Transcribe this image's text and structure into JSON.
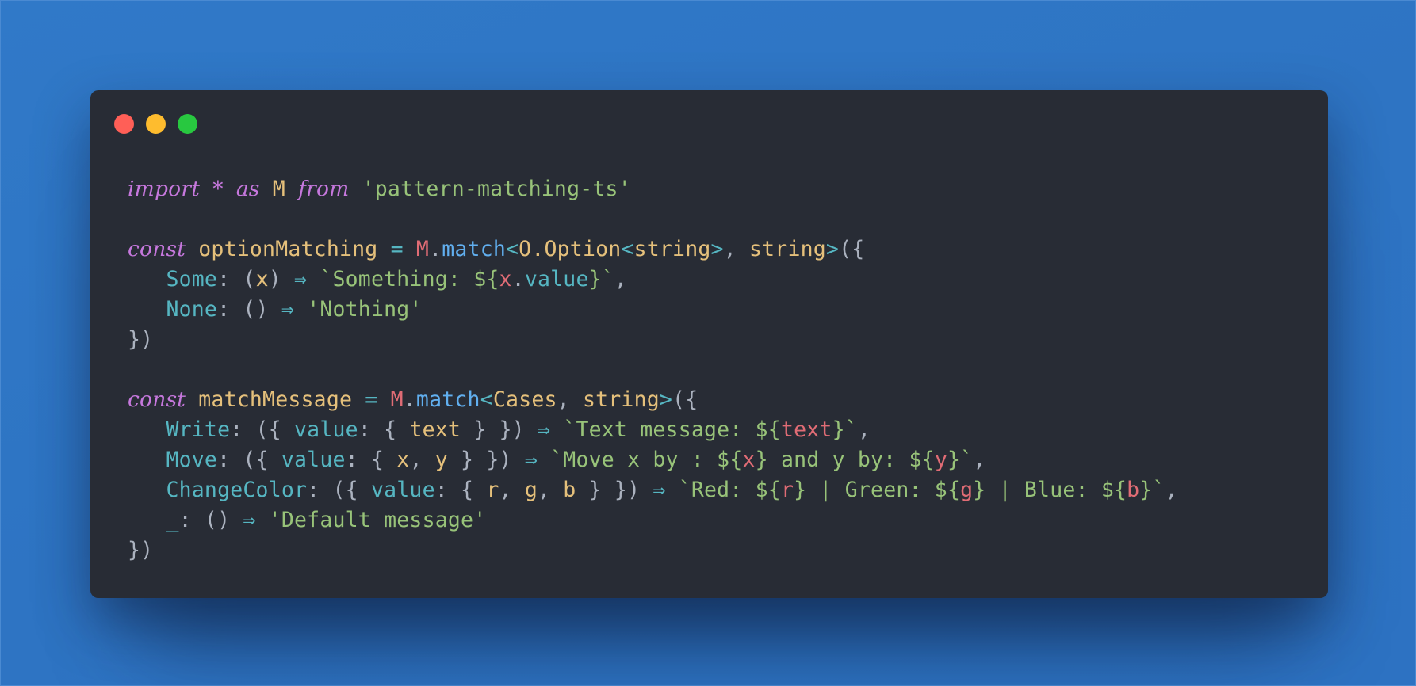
{
  "colors": {
    "background": "#2e75c4",
    "window": "#282c35",
    "dot_close": "#ff5f57",
    "dot_minimize": "#febc2e",
    "dot_maximize": "#28c840",
    "keyword": "#c678dd",
    "identifier": "#e5c07b",
    "string": "#98c379",
    "variable": "#e06c75",
    "function": "#61afef",
    "property": "#56b6c2",
    "punctuation": "#abb2bf"
  },
  "window_controls": [
    "close",
    "minimize",
    "maximize"
  ],
  "code": {
    "language": "typescript",
    "lines": [
      [
        [
          "kw",
          "import"
        ],
        [
          "punct",
          " "
        ],
        [
          "kw",
          "*"
        ],
        [
          "punct",
          " "
        ],
        [
          "kw",
          "as"
        ],
        [
          "punct",
          " "
        ],
        [
          "id",
          "M"
        ],
        [
          "punct",
          " "
        ],
        [
          "kw",
          "from"
        ],
        [
          "punct",
          " "
        ],
        [
          "str",
          "'pattern-matching-ts'"
        ]
      ],
      [],
      [
        [
          "kw",
          "const"
        ],
        [
          "punct",
          " "
        ],
        [
          "id",
          "optionMatching"
        ],
        [
          "punct",
          " "
        ],
        [
          "op",
          "="
        ],
        [
          "punct",
          " "
        ],
        [
          "red",
          "M"
        ],
        [
          "punct",
          "."
        ],
        [
          "fn",
          "match"
        ],
        [
          "op",
          "<"
        ],
        [
          "id",
          "O.Option"
        ],
        [
          "op",
          "<"
        ],
        [
          "id",
          "string"
        ],
        [
          "op",
          ">"
        ],
        [
          "punct",
          ", "
        ],
        [
          "id",
          "string"
        ],
        [
          "op",
          ">"
        ],
        [
          "punct",
          "({"
        ]
      ],
      [
        [
          "punct",
          "   "
        ],
        [
          "prop",
          "Some"
        ],
        [
          "punct",
          ": ("
        ],
        [
          "id",
          "x"
        ],
        [
          "punct",
          ") "
        ],
        [
          "arrow",
          "⇒"
        ],
        [
          "punct",
          " "
        ],
        [
          "str",
          "`Something: ${"
        ],
        [
          "red",
          "x"
        ],
        [
          "punct",
          "."
        ],
        [
          "prop",
          "value"
        ],
        [
          "str",
          "}`"
        ],
        [
          "punct",
          ","
        ]
      ],
      [
        [
          "punct",
          "   "
        ],
        [
          "prop",
          "None"
        ],
        [
          "punct",
          ": () "
        ],
        [
          "arrow",
          "⇒"
        ],
        [
          "punct",
          " "
        ],
        [
          "str",
          "'Nothing'"
        ]
      ],
      [
        [
          "punct",
          "})"
        ]
      ],
      [],
      [
        [
          "kw",
          "const"
        ],
        [
          "punct",
          " "
        ],
        [
          "id",
          "matchMessage"
        ],
        [
          "punct",
          " "
        ],
        [
          "op",
          "="
        ],
        [
          "punct",
          " "
        ],
        [
          "red",
          "M"
        ],
        [
          "punct",
          "."
        ],
        [
          "fn",
          "match"
        ],
        [
          "op",
          "<"
        ],
        [
          "id",
          "Cases"
        ],
        [
          "punct",
          ", "
        ],
        [
          "id",
          "string"
        ],
        [
          "op",
          ">"
        ],
        [
          "punct",
          "({"
        ]
      ],
      [
        [
          "punct",
          "   "
        ],
        [
          "prop",
          "Write"
        ],
        [
          "punct",
          ": ({ "
        ],
        [
          "prop",
          "value"
        ],
        [
          "punct",
          ": { "
        ],
        [
          "id",
          "text"
        ],
        [
          "punct",
          " } }) "
        ],
        [
          "arrow",
          "⇒"
        ],
        [
          "punct",
          " "
        ],
        [
          "str",
          "`Text message: ${"
        ],
        [
          "red",
          "text"
        ],
        [
          "str",
          "}`"
        ],
        [
          "punct",
          ","
        ]
      ],
      [
        [
          "punct",
          "   "
        ],
        [
          "prop",
          "Move"
        ],
        [
          "punct",
          ": ({ "
        ],
        [
          "prop",
          "value"
        ],
        [
          "punct",
          ": { "
        ],
        [
          "id",
          "x"
        ],
        [
          "punct",
          ", "
        ],
        [
          "id",
          "y"
        ],
        [
          "punct",
          " } }) "
        ],
        [
          "arrow",
          "⇒"
        ],
        [
          "punct",
          " "
        ],
        [
          "str",
          "`Move x by : ${"
        ],
        [
          "red",
          "x"
        ],
        [
          "str",
          "} and y by: ${"
        ],
        [
          "red",
          "y"
        ],
        [
          "str",
          "}`"
        ],
        [
          "punct",
          ","
        ]
      ],
      [
        [
          "punct",
          "   "
        ],
        [
          "prop",
          "ChangeColor"
        ],
        [
          "punct",
          ": ({ "
        ],
        [
          "prop",
          "value"
        ],
        [
          "punct",
          ": { "
        ],
        [
          "id",
          "r"
        ],
        [
          "punct",
          ", "
        ],
        [
          "id",
          "g"
        ],
        [
          "punct",
          ", "
        ],
        [
          "id",
          "b"
        ],
        [
          "punct",
          " } }) "
        ],
        [
          "arrow",
          "⇒"
        ],
        [
          "punct",
          " "
        ],
        [
          "str",
          "`Red: ${"
        ],
        [
          "red",
          "r"
        ],
        [
          "str",
          "} | Green: ${"
        ],
        [
          "red",
          "g"
        ],
        [
          "str",
          "} | Blue: ${"
        ],
        [
          "red",
          "b"
        ],
        [
          "str",
          "}`"
        ],
        [
          "punct",
          ","
        ]
      ],
      [
        [
          "punct",
          "   "
        ],
        [
          "prop",
          "_"
        ],
        [
          "punct",
          ": () "
        ],
        [
          "arrow",
          "⇒"
        ],
        [
          "punct",
          " "
        ],
        [
          "str",
          "'Default message'"
        ]
      ],
      [
        [
          "punct",
          "})"
        ]
      ]
    ]
  }
}
